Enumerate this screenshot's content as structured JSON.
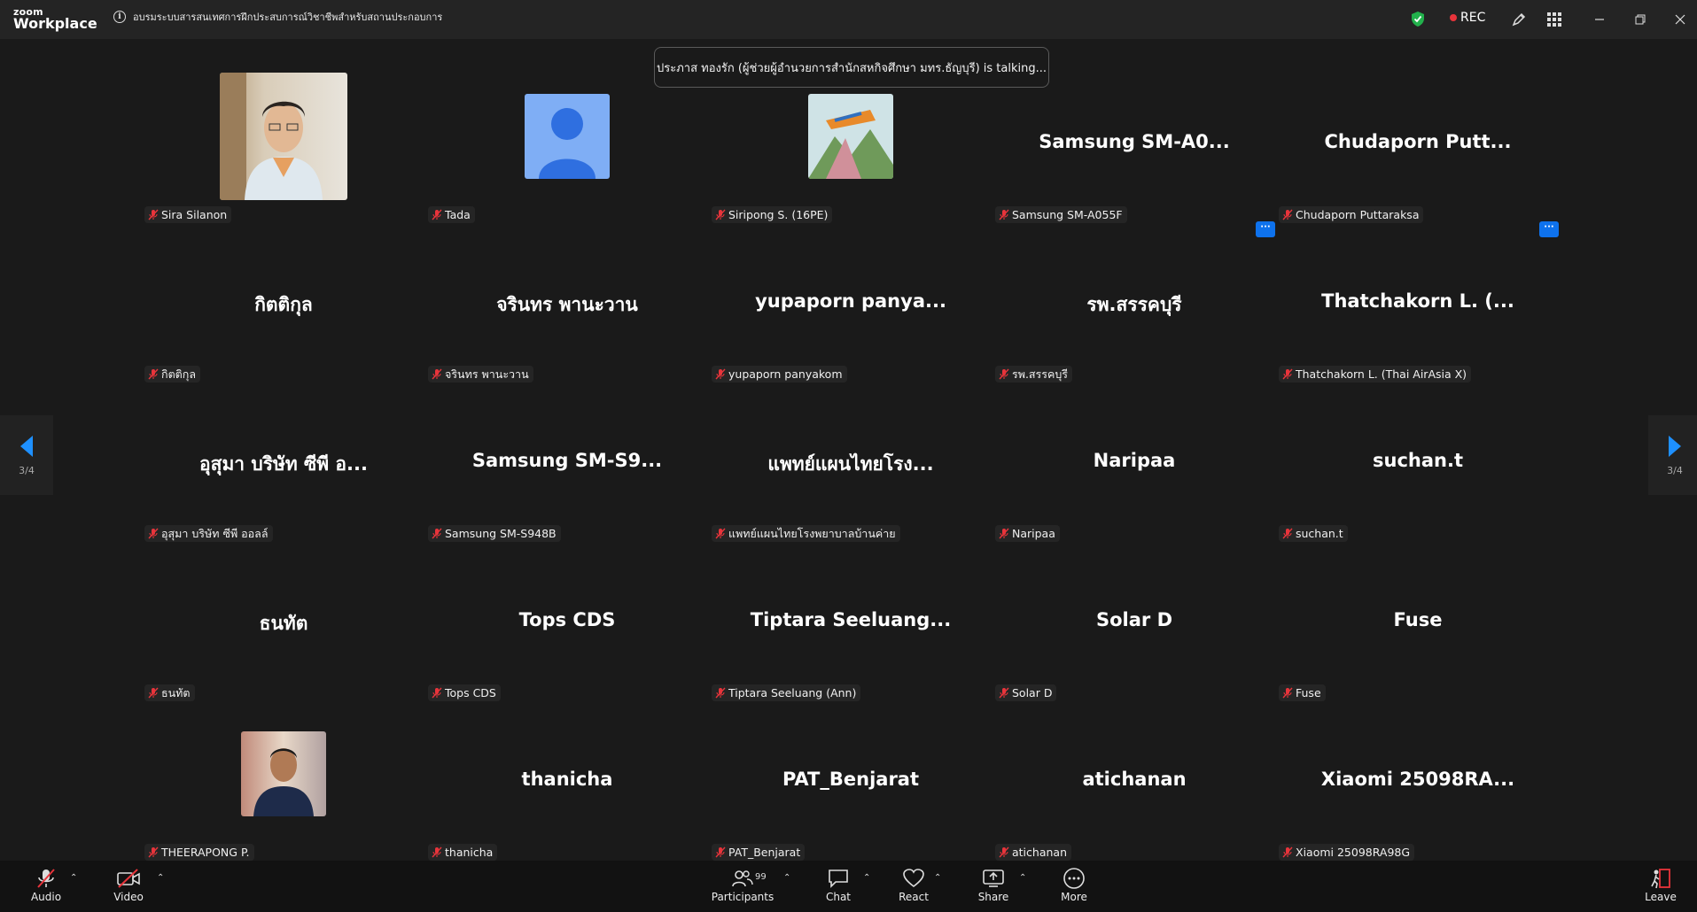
{
  "app": {
    "brand_line1": "zoom",
    "brand_line2": "Workplace"
  },
  "meeting": {
    "title": "อบรมระบบสารสนเทศการฝึกประสบการณ์วิชาชีพสำหรับสถานประกอบการ"
  },
  "recording": {
    "label": "REC"
  },
  "toast": {
    "text": "ประภาส ทองรัก (ผู้ช่วยผู้อำนวยการสำนักสหกิจศึกษา มทร.ธัญบุรี) is talking..."
  },
  "pagination": {
    "left": "3/4",
    "right": "3/4"
  },
  "tiles": [
    {
      "display": "",
      "label": "Sira Silanon"
    },
    {
      "display": "",
      "label": "Tada"
    },
    {
      "display": "",
      "label": "Siripong S. (16PE)"
    },
    {
      "display": "Samsung  SM-A0...",
      "label": "Samsung SM-A055F"
    },
    {
      "display": "Chudaporn  Putt...",
      "label": "Chudaporn Puttaraksa"
    },
    {
      "display": "กิตติกุล",
      "label": "กิตติกุล"
    },
    {
      "display": "จรินทร  พานะวาน",
      "label": "จรินทร พานะวาน"
    },
    {
      "display": "yupaporn  panya...",
      "label": "yupaporn panyakom"
    },
    {
      "display": "รพ.สรรคบุรี",
      "label": "รพ.สรรคบุรี"
    },
    {
      "display": "Thatchakorn  L.  (...",
      "label": "Thatchakorn L. (Thai AirAsia X)"
    },
    {
      "display": "อุสุมา  บริษัท  ซีพี  อ...",
      "label": "อุสุมา บริษัท ซีพี ออลล์"
    },
    {
      "display": "Samsung  SM-S9...",
      "label": "Samsung SM-S948B"
    },
    {
      "display": "แพทย์แผนไทยโรง...",
      "label": "แพทย์แผนไทยโรงพยาบาลบ้านค่าย"
    },
    {
      "display": "Naripaa",
      "label": "Naripaa"
    },
    {
      "display": "suchan.t",
      "label": "suchan.t"
    },
    {
      "display": "ธนทัต",
      "label": "ธนทัต"
    },
    {
      "display": "Tops CDS",
      "label": "Tops CDS"
    },
    {
      "display": "Tiptara  Seeluang...",
      "label": "Tiptara Seeluang (Ann)"
    },
    {
      "display": "Solar D",
      "label": "Solar D"
    },
    {
      "display": "Fuse",
      "label": "Fuse"
    },
    {
      "display": "",
      "label": "THEERAPONG P."
    },
    {
      "display": "thanicha",
      "label": "thanicha"
    },
    {
      "display": "PAT_Benjarat",
      "label": "PAT_Benjarat"
    },
    {
      "display": "atichanan",
      "label": "atichanan"
    },
    {
      "display": "Xiaomi  25098RA...",
      "label": "Xiaomi 25098RA98G"
    }
  ],
  "toolbar": {
    "audio": "Audio",
    "video": "Video",
    "participants": "Participants",
    "participants_count": "99",
    "chat": "Chat",
    "react": "React",
    "share": "Share",
    "more": "More",
    "leave": "Leave"
  },
  "colors": {
    "accent": "#0e72ed",
    "rec": "#e8343b",
    "muted": "#e8343b",
    "shield": "#22b14c"
  }
}
